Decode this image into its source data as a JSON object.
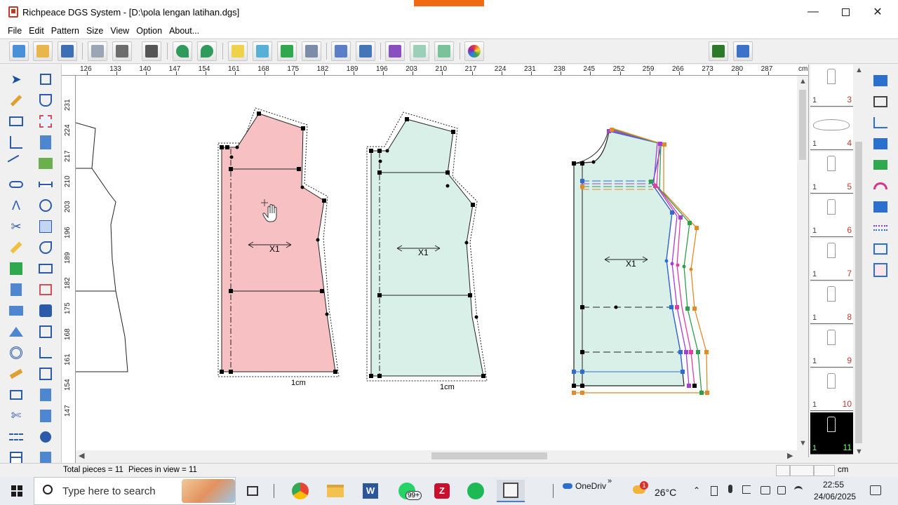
{
  "window": {
    "title": "Richpeace DGS System - [D:\\pola lengan latihan.dgs]",
    "minimize_icon": "minimize-icon",
    "maximize_icon": "maximize-icon",
    "close_icon": "close-icon"
  },
  "menu": [
    "File",
    "Edit",
    "Pattern",
    "Size",
    "View",
    "Option",
    "About..."
  ],
  "toolbar": {
    "pen_width_value": "2",
    "line_color": "#000000"
  },
  "rulers": {
    "horizontal_ticks": [
      "126",
      "133",
      "140",
      "147",
      "154",
      "161",
      "168",
      "175",
      "182",
      "189",
      "196",
      "203",
      "210",
      "217",
      "224",
      "231",
      "238",
      "245",
      "252",
      "259",
      "266",
      "273",
      "280",
      "287"
    ],
    "horizontal_unit": "cm",
    "vertical_ticks": [
      "231",
      "224",
      "217",
      "210",
      "203",
      "196",
      "189",
      "182",
      "175",
      "168",
      "161",
      "154",
      "147"
    ]
  },
  "canvas": {
    "piece_pink": {
      "quantity_label": "X1",
      "scale_label": "1cm",
      "fill": "#f7c1c4"
    },
    "piece_mint": {
      "quantity_label": "X1",
      "scale_label": "1cm",
      "fill": "#d9f0e8"
    },
    "piece_graded": {
      "quantity_label": "X1",
      "fill": "#d9f0e8"
    }
  },
  "piece_list": [
    {
      "qty": "1",
      "num": "3"
    },
    {
      "qty": "1",
      "num": "4"
    },
    {
      "qty": "1",
      "num": "5"
    },
    {
      "qty": "1",
      "num": "6"
    },
    {
      "qty": "1",
      "num": "7"
    },
    {
      "qty": "1",
      "num": "8"
    },
    {
      "qty": "1",
      "num": "9"
    },
    {
      "qty": "1",
      "num": "10"
    },
    {
      "qty": "1",
      "num": "11"
    }
  ],
  "status": {
    "total_pieces": "Total pieces = 11",
    "pieces_in_view": "Pieces in view = 11",
    "unit": "cm"
  },
  "taskbar": {
    "search_placeholder": "Type here to search",
    "whatsapp_badge": "99+",
    "onedrive_label": "OneDriv",
    "weather_badge": "1",
    "temperature": "26°C",
    "time": "22:55",
    "date": "24/06/2025"
  }
}
